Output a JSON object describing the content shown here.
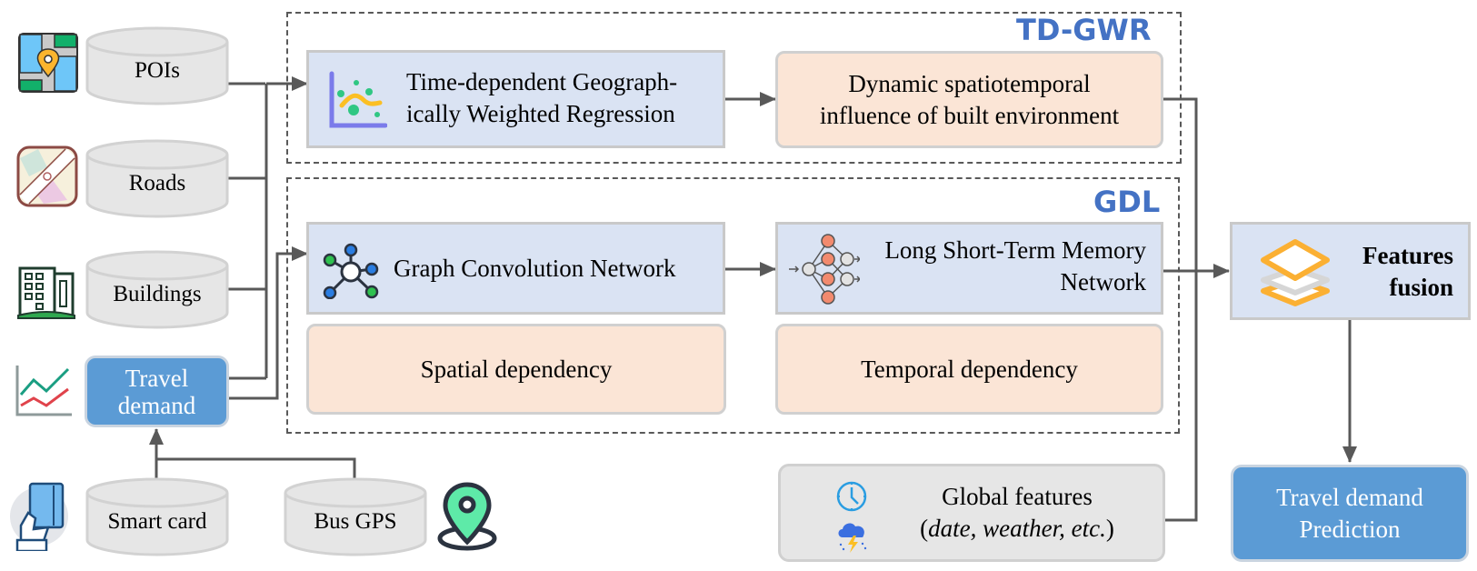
{
  "inputs": {
    "pois": {
      "label": "POIs",
      "icon": "map-pin-icon"
    },
    "roads": {
      "label": "Roads",
      "icon": "road-map-icon"
    },
    "buildings": {
      "label": "Buildings",
      "icon": "buildings-icon"
    },
    "travel_demand": {
      "label_line1": "Travel",
      "label_line2": "demand",
      "icon": "line-chart-icon"
    },
    "smart_card": {
      "label": "Smart card",
      "icon": "smart-card-hand-icon"
    },
    "bus_gps": {
      "label": "Bus GPS",
      "icon": "location-pin-icon"
    }
  },
  "groups": {
    "tdgwr": {
      "title": "TD-GWR"
    },
    "gdl": {
      "title": "GDL"
    }
  },
  "modules": {
    "tdgwr_model": {
      "line1": "Time-dependent Geograph-",
      "line2": "ically Weighted Regression",
      "icon": "scatter-regression-icon"
    },
    "dynamic_influence": {
      "line1": "Dynamic spatiotemporal",
      "line2": "influence of built environment"
    },
    "gcn": {
      "label": "Graph Convolution Network",
      "icon": "graph-network-icon"
    },
    "lstm": {
      "line1": "Long Short-Term Memory",
      "line2": "Network",
      "icon": "neural-network-icon"
    },
    "spatial": {
      "label": "Spatial dependency"
    },
    "temporal": {
      "label": "Temporal dependency"
    },
    "global_features": {
      "line1": "Global features",
      "line2_open": "(",
      "line2_italic": "date, weather, etc.",
      "line2_close": ")",
      "icons": [
        "clock-icon",
        "storm-cloud-icon"
      ]
    },
    "fusion": {
      "line1": "Features",
      "line2": "fusion",
      "icon": "layers-icon"
    },
    "prediction": {
      "line1": "Travel demand",
      "line2": "Prediction"
    }
  },
  "colors": {
    "group_title": "#4472c4",
    "module_blue": "#dae3f3",
    "module_peach": "#fbe5d6",
    "input_gray": "#e6e6e6",
    "accent_blue": "#5b9bd5",
    "connector": "#595959"
  }
}
